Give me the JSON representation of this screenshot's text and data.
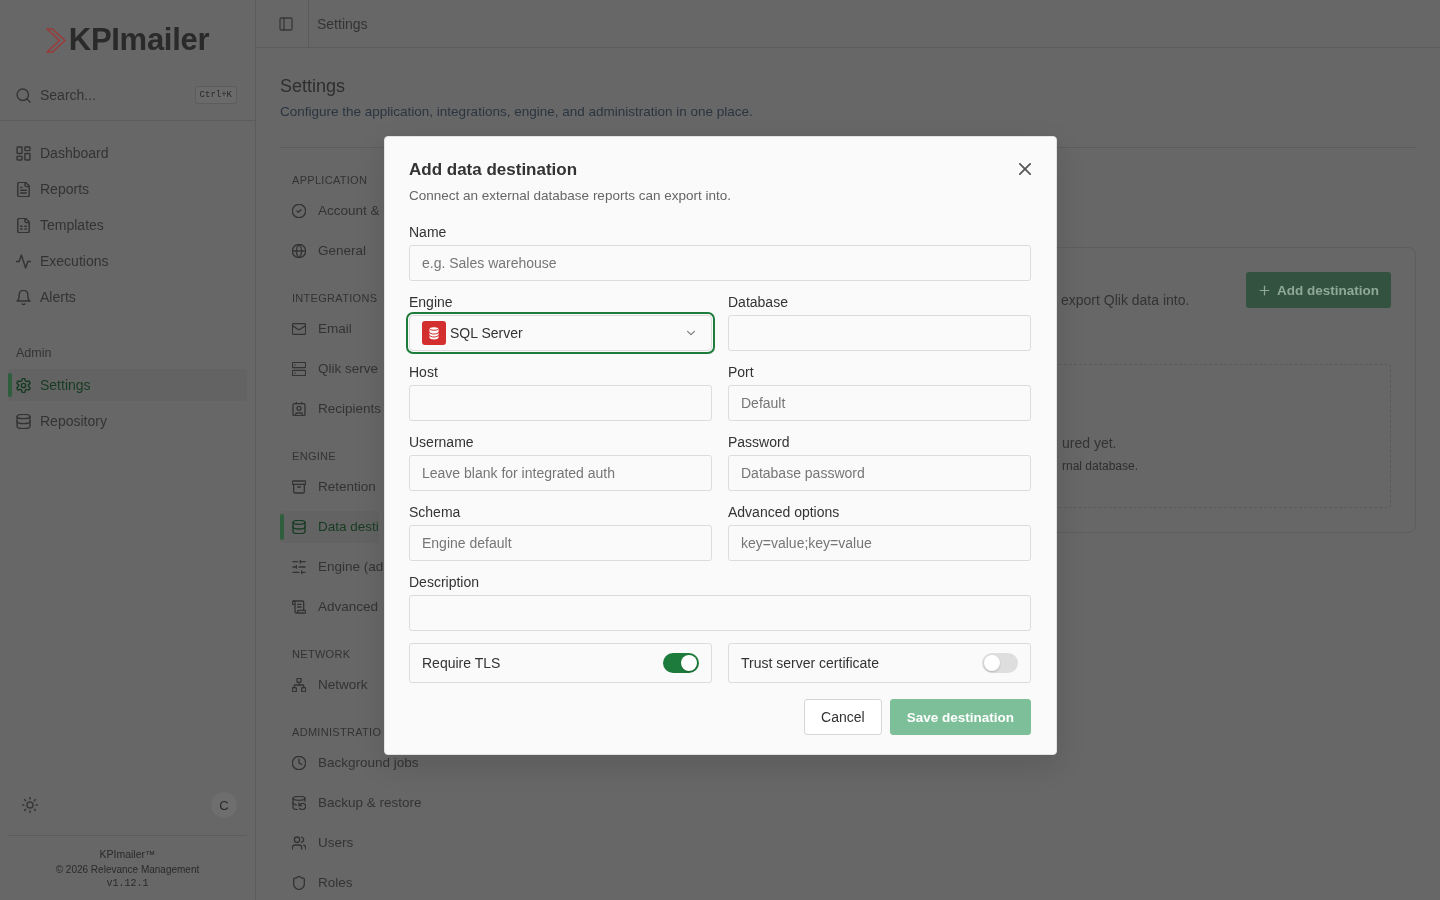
{
  "sidebar": {
    "logo": "KPImailer",
    "search": {
      "placeholder": "Search...",
      "shortcut": "Ctrl+K"
    },
    "groups": [
      {
        "items": [
          {
            "label": "Dashboard",
            "selected": false
          },
          {
            "label": "Reports",
            "selected": false
          },
          {
            "label": "Templates",
            "selected": false
          },
          {
            "label": "Executions",
            "selected": false
          },
          {
            "label": "Alerts",
            "selected": false
          }
        ]
      },
      {
        "heading": "Admin",
        "items": [
          {
            "label": "Settings",
            "selected": true
          },
          {
            "label": "Repository",
            "selected": false
          }
        ]
      }
    ],
    "avatar": "C",
    "footer": {
      "product": "KPImailer™",
      "copyright": "© 2026 Relevance Management",
      "version": "v1.12.1"
    }
  },
  "topbar": {
    "breadcrumb": "Settings"
  },
  "page": {
    "title": "Settings",
    "subtitle": "Configure the application, integrations, engine, and administration in one place."
  },
  "settings_nav": [
    {
      "heading": "APPLICATION",
      "items": [
        {
          "label": "Account &",
          "selected": false
        },
        {
          "label": "General",
          "selected": false
        }
      ]
    },
    {
      "heading": "INTEGRATIONS",
      "items": [
        {
          "label": "Email",
          "selected": false
        },
        {
          "label": "Qlik serve",
          "selected": false
        },
        {
          "label": "Recipients",
          "selected": false
        }
      ]
    },
    {
      "heading": "ENGINE",
      "items": [
        {
          "label": "Retention",
          "selected": false
        },
        {
          "label": "Data desti",
          "selected": true
        },
        {
          "label": "Engine (ad",
          "selected": false
        },
        {
          "label": "Advanced",
          "selected": false
        }
      ]
    },
    {
      "heading": "NETWORK",
      "items": [
        {
          "label": "Network",
          "selected": false
        }
      ]
    },
    {
      "heading": "ADMINISTRATIO",
      "items": [
        {
          "label": "Background jobs",
          "selected": false
        },
        {
          "label": "Backup & restore",
          "selected": false
        },
        {
          "label": "Users",
          "selected": false
        },
        {
          "label": "Roles",
          "selected": false
        }
      ]
    }
  ],
  "destinations_card": {
    "description": "export Qlik data into.",
    "add_button": "Add destination",
    "empty_state": {
      "title": "ured yet.",
      "hint": "rnal database."
    }
  },
  "dialog": {
    "title": "Add data destination",
    "subtitle": "Connect an external database reports can export into.",
    "rows": [
      [
        {
          "kind": "text",
          "label": "Name",
          "placeholder": "e.g. Sales warehouse"
        }
      ],
      [
        {
          "kind": "select",
          "label": "Engine",
          "value": "SQL Server",
          "focused": true
        },
        {
          "kind": "text",
          "label": "Database"
        }
      ],
      [
        {
          "kind": "text",
          "label": "Host"
        },
        {
          "kind": "text",
          "label": "Port",
          "placeholder": "Default"
        }
      ],
      [
        {
          "kind": "text",
          "label": "Username",
          "placeholder": "Leave blank for integrated auth"
        },
        {
          "kind": "password",
          "label": "Password",
          "placeholder": "Database password"
        }
      ],
      [
        {
          "kind": "text",
          "label": "Schema",
          "placeholder": "Engine default"
        },
        {
          "kind": "text",
          "label": "Advanced options",
          "placeholder": "key=value;key=value"
        }
      ],
      [
        {
          "kind": "text",
          "label": "Description"
        }
      ],
      [
        {
          "kind": "toggle",
          "label": "Require TLS",
          "on": true
        },
        {
          "kind": "toggle",
          "label": "Trust server certificate",
          "on": false
        }
      ]
    ],
    "buttons": [
      {
        "label": "Cancel",
        "kind": "secondary",
        "disabled": false
      },
      {
        "label": "Save destination",
        "kind": "primary",
        "disabled": true
      }
    ]
  }
}
